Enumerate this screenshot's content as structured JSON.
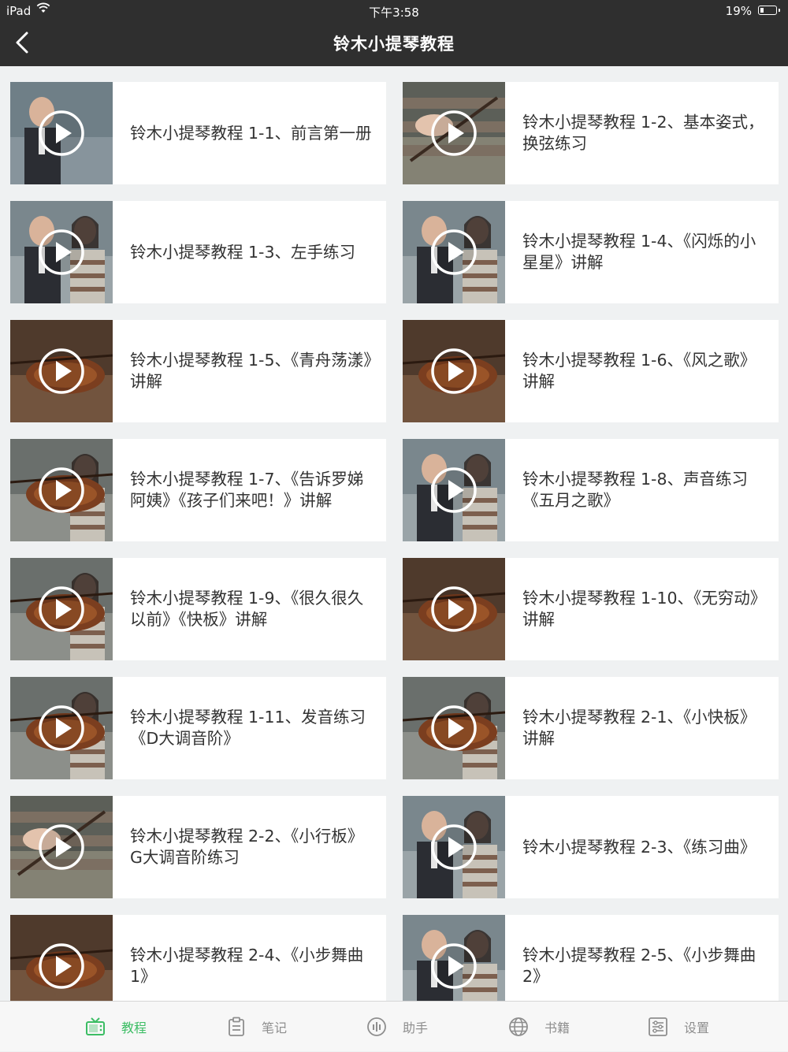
{
  "status_bar": {
    "carrier": "iPad",
    "time": "下午3:58",
    "battery": "19%"
  },
  "header": {
    "title": "铃木小提琴教程"
  },
  "videos": [
    {
      "title": "铃木小提琴教程 1-1、前言第一册",
      "thumb_theme": "man-portrait"
    },
    {
      "title": "铃木小提琴教程 1-2、基本姿式，换弦练习",
      "thumb_theme": "hands-sweater"
    },
    {
      "title": "铃木小提琴教程 1-3、左手练习",
      "thumb_theme": "man-and-girl"
    },
    {
      "title": "铃木小提琴教程 1-4、《闪烁的小星星》讲解",
      "thumb_theme": "man-and-girl"
    },
    {
      "title": "铃木小提琴教程 1-5、《青舟荡漾》讲解",
      "thumb_theme": "violin-closeup"
    },
    {
      "title": "铃木小提琴教程 1-6、《风之歌》讲解",
      "thumb_theme": "violin-closeup"
    },
    {
      "title": "铃木小提琴教程 1-7、《告诉罗娣阿姨》《孩子们来吧！》讲解",
      "thumb_theme": "girl-violin"
    },
    {
      "title": "铃木小提琴教程 1-8、声音练习《五月之歌》",
      "thumb_theme": "man-and-girl"
    },
    {
      "title": "铃木小提琴教程 1-9、《很久很久以前》《快板》讲解",
      "thumb_theme": "girl-violin"
    },
    {
      "title": "铃木小提琴教程 1-10、《无穷动》讲解",
      "thumb_theme": "violin-closeup"
    },
    {
      "title": "铃木小提琴教程 1-11、发音练习《D大调音阶》",
      "thumb_theme": "girl-violin"
    },
    {
      "title": "铃木小提琴教程 2-1、《小快板》讲解",
      "thumb_theme": "girl-violin"
    },
    {
      "title": "铃木小提琴教程 2-2、《小行板》G大调音阶练习",
      "thumb_theme": "hands-sweater"
    },
    {
      "title": "铃木小提琴教程 2-3、《练习曲》",
      "thumb_theme": "man-and-girl"
    },
    {
      "title": "铃木小提琴教程 2-4、《小步舞曲1》",
      "thumb_theme": "violin-closeup"
    },
    {
      "title": "铃木小提琴教程 2-5、《小步舞曲2》",
      "thumb_theme": "man-and-girl"
    }
  ],
  "tabs": [
    {
      "label": "教程",
      "icon": "tv-icon",
      "active": true
    },
    {
      "label": "笔记",
      "icon": "clipboard-icon",
      "active": false
    },
    {
      "label": "助手",
      "icon": "audio-bars-icon",
      "active": false
    },
    {
      "label": "书籍",
      "icon": "globe-icon",
      "active": false
    },
    {
      "label": "设置",
      "icon": "settings-list-icon",
      "active": false
    }
  ],
  "colors": {
    "header_bg": "#2f2f2f",
    "accent": "#3cbd64",
    "tab_inactive": "#8e8e8e",
    "page_bg": "#eff1f2"
  }
}
